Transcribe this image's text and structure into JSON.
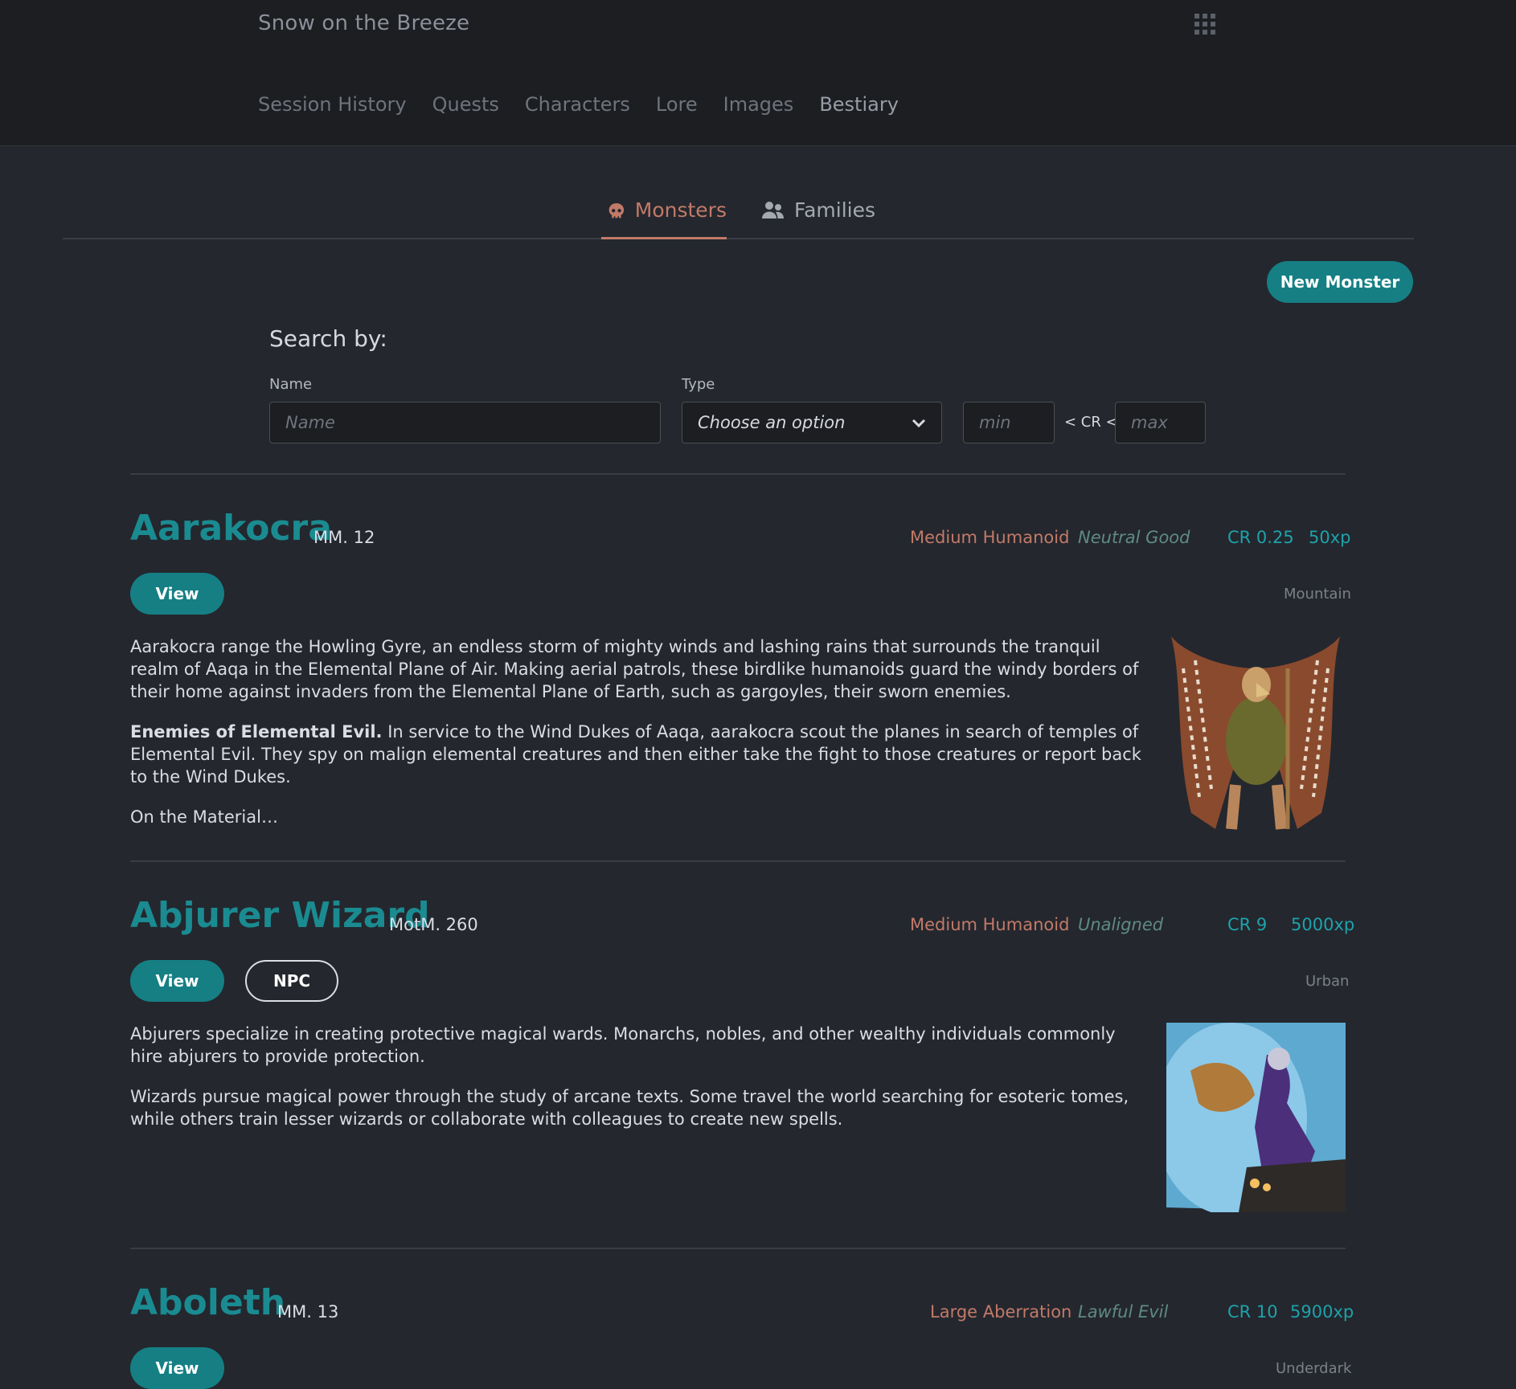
{
  "header": {
    "app_title": "Snow on the Breeze",
    "nav": [
      "Session History",
      "Quests",
      "Characters",
      "Lore",
      "Images",
      "Bestiary"
    ]
  },
  "tabs": {
    "monsters": "Monsters",
    "families": "Families"
  },
  "toolbar": {
    "new_monster": "New Monster"
  },
  "search": {
    "title": "Search by:",
    "name_label": "Name",
    "name_placeholder": "Name",
    "type_label": "Type",
    "type_value": "Choose an option",
    "min_placeholder": "min",
    "cr_separator": "< CR <",
    "max_placeholder": "max"
  },
  "monsters": [
    {
      "name": "Aarakocra",
      "source": "MM. 12",
      "size_type": "Medium Humanoid",
      "alignment": "Neutral Good",
      "cr": "CR 0.25",
      "xp": "50xp",
      "environment": "Mountain",
      "view": "View",
      "p1": "Aarakocra range the Howling Gyre, an endless storm of mighty winds and lashing rains that surrounds the tranquil realm of Aaqa in the Elemental Plane of Air. Making aerial patrols, these birdlike humanoids guard the windy borders of their home against invaders from the Elemental Plane of Earth, such as gargoyles, their sworn enemies.",
      "p2_bold": "Enemies of Elemental Evil.",
      "p2": " In service to the Wind Dukes of Aaqa, aarakocra scout the planes in search of temples of Elemental Evil. They spy on malign elemental creatures and then either take the fight to those creatures or report back to the Wind Dukes.",
      "p3": "On the Material…"
    },
    {
      "name": "Abjurer Wizard",
      "source": "MotM. 260",
      "size_type": "Medium Humanoid",
      "alignment": "Unaligned",
      "cr": "CR 9",
      "xp": "5000xp",
      "environment": "Urban",
      "view": "View",
      "tag": "NPC",
      "p1": "Abjurers specialize in creating protective magical wards. Monarchs, nobles, and other wealthy individuals commonly hire abjurers to provide protection.",
      "p2": "Wizards pursue magical power through the study of arcane texts. Some travel the world searching for esoteric tomes, while others train lesser wizards or collaborate with colleagues to create new spells."
    },
    {
      "name": "Aboleth",
      "source": "MM. 13",
      "size_type": "Large Aberration",
      "alignment": "Lawful Evil",
      "cr": "CR 10",
      "xp": "5900xp",
      "environment": "Underdark",
      "view": "View"
    }
  ],
  "colors": {
    "accent": "#157f84",
    "type_color": "#c27a68",
    "background": "#24272e"
  }
}
